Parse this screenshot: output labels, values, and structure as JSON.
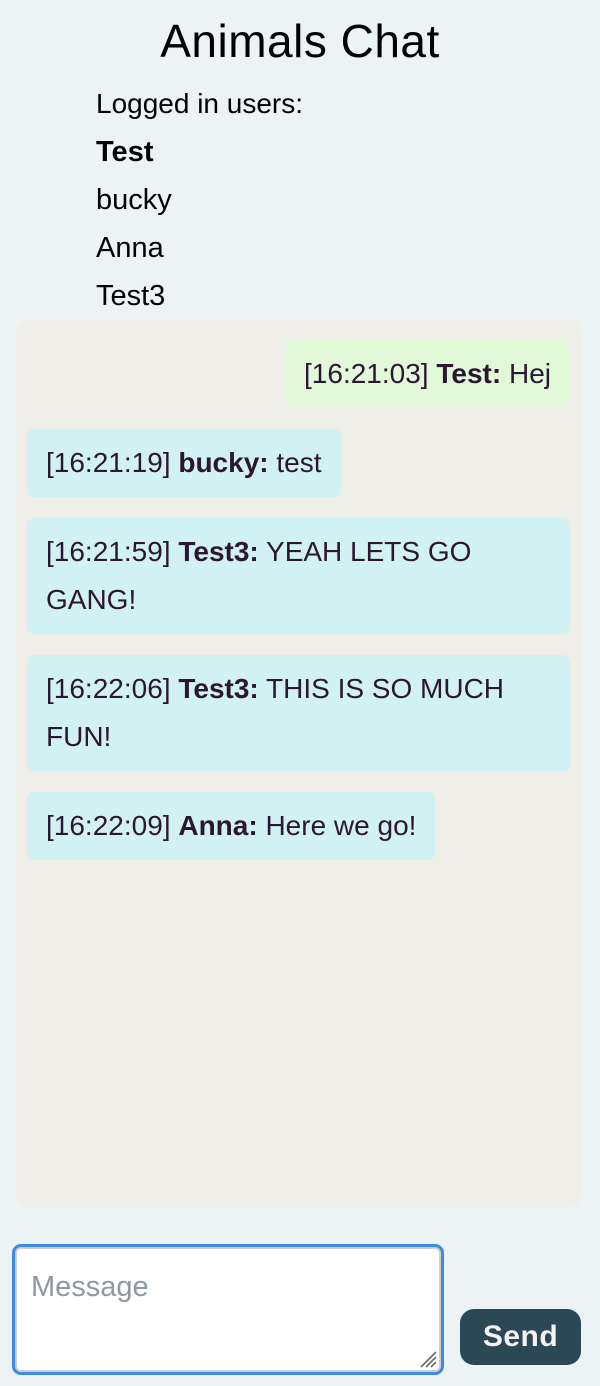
{
  "header": {
    "title": "Animals Chat"
  },
  "users": {
    "heading": "Logged in users:",
    "list": [
      {
        "name": "Test",
        "current": true
      },
      {
        "name": "bucky",
        "current": false
      },
      {
        "name": "Anna",
        "current": false
      },
      {
        "name": "Test3",
        "current": false
      }
    ]
  },
  "messages": [
    {
      "time": "[16:21:03]",
      "user": "Test:",
      "text": "Hej",
      "own": true
    },
    {
      "time": "[16:21:19]",
      "user": "bucky:",
      "text": "test",
      "own": false
    },
    {
      "time": "[16:21:59]",
      "user": "Test3:",
      "text": "YEAH LETS GO GANG!",
      "own": false
    },
    {
      "time": "[16:22:06]",
      "user": "Test3:",
      "text": "THIS IS SO MUCH FUN!",
      "own": false
    },
    {
      "time": "[16:22:09]",
      "user": "Anna:",
      "text": "Here we go!",
      "own": false
    }
  ],
  "composer": {
    "placeholder": "Message",
    "value": "",
    "send_label": "Send"
  },
  "colors": {
    "own_bubble": "#e1f8d9",
    "other_bubble": "#d2f1f2",
    "chat_bg": "#f0eee9",
    "send_button": "#2c4756",
    "input_focus": "#3d8ae6"
  }
}
